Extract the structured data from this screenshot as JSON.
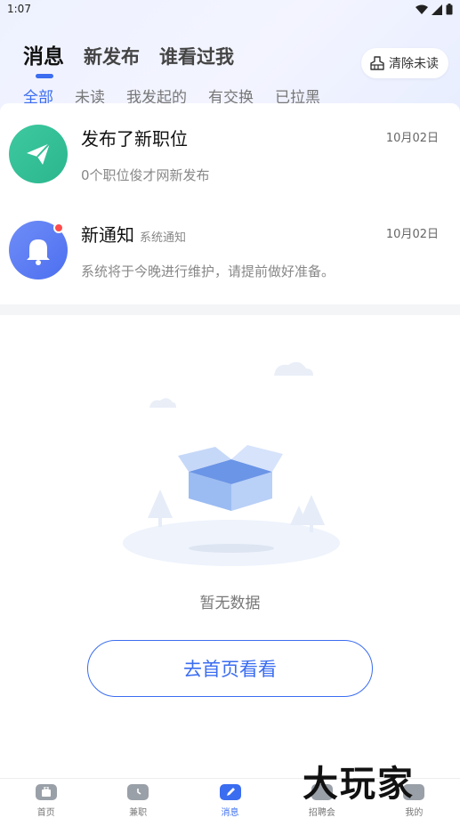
{
  "status_bar": {
    "time": "1:07"
  },
  "header": {
    "tabs": [
      {
        "label": "消息",
        "active": true
      },
      {
        "label": "新发布",
        "active": false
      },
      {
        "label": "谁看过我",
        "active": false
      }
    ],
    "clear_button_label": "清除未读"
  },
  "sub_tabs": [
    {
      "label": "全部",
      "active": true
    },
    {
      "label": "未读",
      "active": false
    },
    {
      "label": "我发起的",
      "active": false
    },
    {
      "label": "有交换",
      "active": false
    },
    {
      "label": "已拉黑",
      "active": false
    }
  ],
  "messages": [
    {
      "title": "发布了新职位",
      "tag": "",
      "date": "10月02日",
      "preview": "0个职位俊才网新发布",
      "icon": "paper-plane-icon",
      "color": "#34bf96",
      "unread": false
    },
    {
      "title": "新通知",
      "tag": "系统通知",
      "date": "10月02日",
      "preview": "系统将于今晚进行维护，请提前做好准备。",
      "icon": "bell-icon",
      "color": "#5a7cf4",
      "unread": true
    }
  ],
  "empty_state": {
    "text": "暂无数据",
    "button_label": "去首页看看"
  },
  "tabbar": [
    {
      "label": "首页",
      "icon": "home-bag-icon",
      "active": false
    },
    {
      "label": "兼职",
      "icon": "clock-icon",
      "active": false
    },
    {
      "label": "消息",
      "icon": "message-edit-icon",
      "active": true
    },
    {
      "label": "招聘会",
      "icon": "fair-icon",
      "active": false
    },
    {
      "label": "我的",
      "icon": "profile-icon",
      "active": false
    }
  ],
  "watermark": "大玩家",
  "colors": {
    "accent": "#3b6df0",
    "unread_dot": "#ff4b4b"
  }
}
